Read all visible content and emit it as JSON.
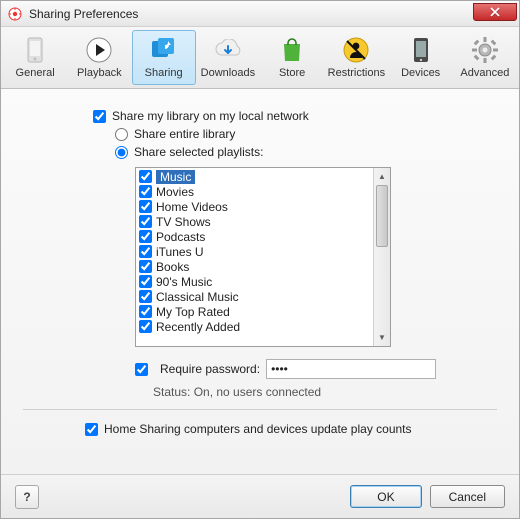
{
  "window": {
    "title": "Sharing Preferences"
  },
  "toolbar": {
    "items": [
      {
        "label": "General"
      },
      {
        "label": "Playback"
      },
      {
        "label": "Sharing"
      },
      {
        "label": "Downloads"
      },
      {
        "label": "Store"
      },
      {
        "label": "Restrictions"
      },
      {
        "label": "Devices"
      },
      {
        "label": "Advanced"
      }
    ],
    "selected_index": 2
  },
  "sharing": {
    "share_label": "Share my library on my local network",
    "share_checked": true,
    "entire_label": "Share entire library",
    "selected_label": "Share selected playlists:",
    "radio_value": "selected",
    "playlists": [
      {
        "label": "Music",
        "checked": true,
        "selected": true
      },
      {
        "label": "Movies",
        "checked": true
      },
      {
        "label": "Home Videos",
        "checked": true
      },
      {
        "label": "TV Shows",
        "checked": true
      },
      {
        "label": "Podcasts",
        "checked": true
      },
      {
        "label": "iTunes U",
        "checked": true
      },
      {
        "label": "Books",
        "checked": true
      },
      {
        "label": "90's Music",
        "checked": true
      },
      {
        "label": "Classical Music",
        "checked": true
      },
      {
        "label": "My Top Rated",
        "checked": true
      },
      {
        "label": "Recently Added",
        "checked": true
      }
    ],
    "require_pw_label": "Require password:",
    "require_pw_checked": true,
    "password_display": "••••",
    "status_label": "Status: On, no users connected",
    "home_sharing_label": "Home Sharing computers and devices update play counts",
    "home_sharing_checked": true
  },
  "buttons": {
    "help": "?",
    "ok": "OK",
    "cancel": "Cancel"
  }
}
